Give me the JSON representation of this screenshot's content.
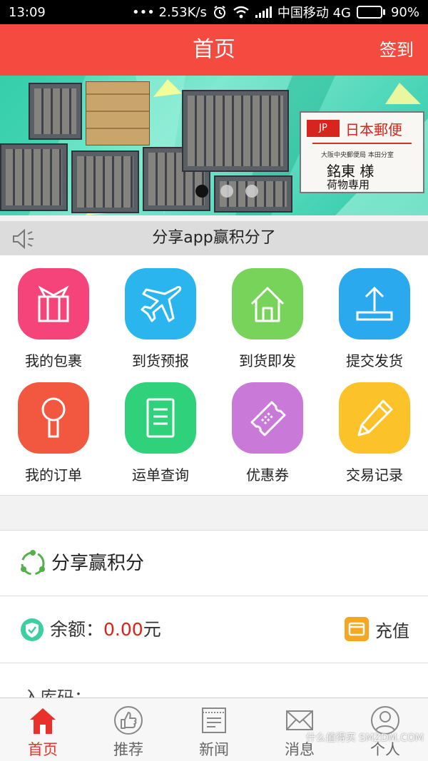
{
  "status_bar": {
    "time": "13:09",
    "network_speed": "••• 2.53K/s",
    "carrier": "中国移动 4G",
    "battery": "90%",
    "battery_level": 0.9
  },
  "header": {
    "title": "首页",
    "action_label": "签到",
    "bg_color": "#f44a3f"
  },
  "banner": {
    "sign_brand": "JP",
    "sign_brand_sub": "POST",
    "sign_title": "日本郵便",
    "sign_line1": "大阪中央郵便局 本田分室",
    "sign_line2": "銘東 様",
    "sign_line3": "荷物専用",
    "slide_count": 3,
    "active_slide": 0
  },
  "notice": {
    "icon": "speaker-icon",
    "text": "分享app赢积分了"
  },
  "menu": {
    "items": [
      {
        "label": "我的包裹",
        "icon": "gift-icon",
        "color": "#f5447a"
      },
      {
        "label": "到货预报",
        "icon": "airplane-icon",
        "color": "#2ab5ef"
      },
      {
        "label": "到货即发",
        "icon": "house-icon",
        "color": "#78d35a"
      },
      {
        "label": "提交发货",
        "icon": "upload-icon",
        "color": "#2aa9ef"
      },
      {
        "label": "我的订单",
        "icon": "magnifier-icon",
        "color": "#f2583f"
      },
      {
        "label": "运单查询",
        "icon": "document-icon",
        "color": "#2fd27a"
      },
      {
        "label": "优惠券",
        "icon": "ticket-icon",
        "color": "#c97ad8"
      },
      {
        "label": "交易记录",
        "icon": "pencil-icon",
        "color": "#fbc22a"
      }
    ]
  },
  "share": {
    "icon": "share-circle-icon",
    "label": "分享赢积分"
  },
  "balance": {
    "label": "余额：",
    "amount": "0.00",
    "unit": "元",
    "recharge_label": "充值",
    "amount_color": "#e0211a"
  },
  "partial_row": {
    "label": "入库码：..."
  },
  "tabbar": {
    "items": [
      {
        "label": "首页",
        "icon": "home-icon",
        "active": true
      },
      {
        "label": "推荐",
        "icon": "thumbs-up-icon",
        "active": false
      },
      {
        "label": "新闻",
        "icon": "news-icon",
        "active": false
      },
      {
        "label": "消息",
        "icon": "mail-icon",
        "active": false
      },
      {
        "label": "个人",
        "icon": "user-icon",
        "active": false
      }
    ],
    "active_color": "#e8312a"
  },
  "watermark": "什么值得买 SMZDM.COM"
}
